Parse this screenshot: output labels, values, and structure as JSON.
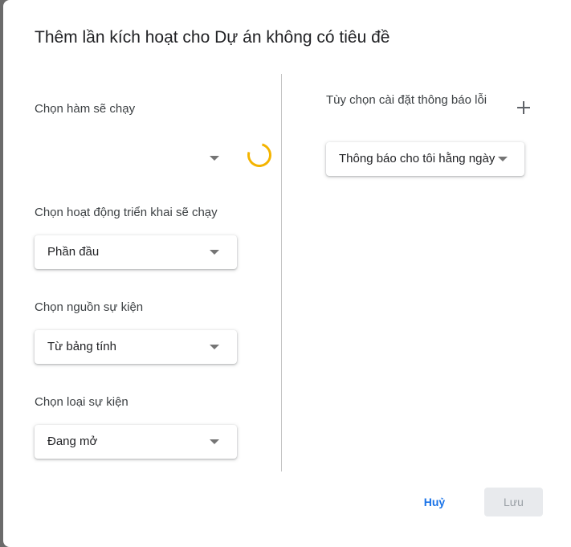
{
  "dialog": {
    "title": "Thêm lần kích hoạt cho Dự án không có tiêu đề"
  },
  "left": {
    "function_label": "Chọn hàm sẽ chạy",
    "function_value": "",
    "deployment_label": "Chọn hoạt động triển khai sẽ chạy",
    "deployment_value": "Phần đầu",
    "event_source_label": "Chọn nguồn sự kiện",
    "event_source_value": "Từ bảng tính",
    "event_type_label": "Chọn loại sự kiện",
    "event_type_value": "Đang mở"
  },
  "right": {
    "failure_label": "Tùy chọn cài đặt thông báo lỗi",
    "failure_value": "Thông báo cho tôi hằng ngày"
  },
  "buttons": {
    "cancel": "Huỷ",
    "save": "Lưu"
  },
  "icons": {
    "spinner": "loading-spinner-icon",
    "add": "plus-icon",
    "dropdown": "caret-down-icon"
  },
  "colors": {
    "accent": "#1a73e8",
    "spinner": "#f4b400",
    "disabled_bg": "#e8eaed",
    "disabled_text": "#9aa0a6"
  }
}
